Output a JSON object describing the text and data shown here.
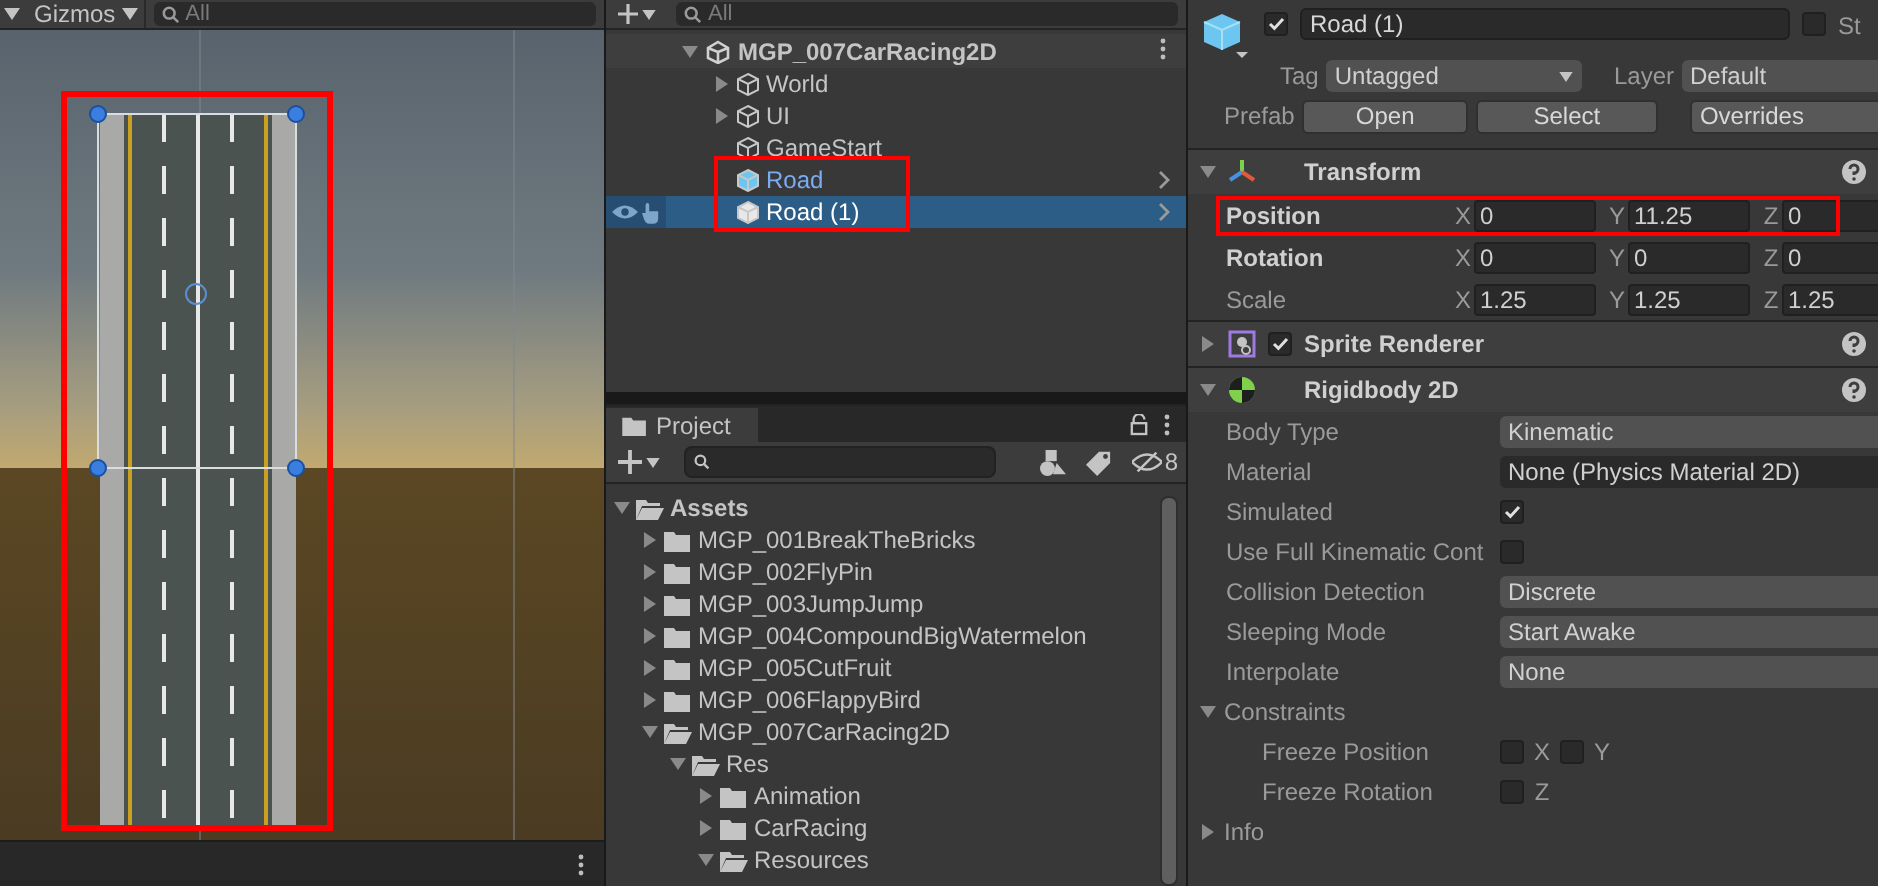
{
  "scene_view": {
    "gizmos_label": "Gizmos",
    "search_placeholder": "All"
  },
  "hierarchy": {
    "search_placeholder": "All",
    "scene": {
      "name": "MGP_007CarRacing2D",
      "expanded": true
    },
    "items": [
      {
        "name": "World",
        "kind": "object",
        "expanded": false,
        "selected": false
      },
      {
        "name": "UI",
        "kind": "object",
        "expanded": false,
        "selected": false
      },
      {
        "name": "GameStart",
        "kind": "object",
        "selected": false
      },
      {
        "name": "Road",
        "kind": "prefab",
        "selected": false
      },
      {
        "name": "Road (1)",
        "kind": "prefab",
        "selected": true
      }
    ]
  },
  "project": {
    "tab": "Project",
    "hidden_count": "8",
    "tree": [
      {
        "name": "Assets",
        "expanded": true,
        "children": [
          {
            "name": "MGP_001BreakTheBricks",
            "expanded": false
          },
          {
            "name": "MGP_002FlyPin",
            "expanded": false
          },
          {
            "name": "MGP_003JumpJump",
            "expanded": false
          },
          {
            "name": "MGP_004CompoundBigWatermelon",
            "expanded": false
          },
          {
            "name": "MGP_005CutFruit",
            "expanded": false
          },
          {
            "name": "MGP_006FlappyBird",
            "expanded": false
          },
          {
            "name": "MGP_007CarRacing2D",
            "expanded": true,
            "children": [
              {
                "name": "Res",
                "expanded": true,
                "children": [
                  {
                    "name": "Animation",
                    "expanded": false
                  },
                  {
                    "name": "CarRacing",
                    "expanded": false
                  },
                  {
                    "name": "Resources",
                    "expanded": true
                  }
                ]
              }
            ]
          }
        ]
      }
    ]
  },
  "inspector": {
    "name": "Road (1)",
    "active": true,
    "static_label": "St",
    "static": false,
    "tag_label": "Tag",
    "tag": "Untagged",
    "layer_label": "Layer",
    "layer": "Default",
    "prefab_label": "Prefab",
    "prefab_buttons": [
      "Open",
      "Select",
      "Overrides"
    ],
    "components": [
      {
        "kind": "transform",
        "title": "Transform",
        "expanded": true,
        "rows": [
          {
            "label": "Position",
            "overridden": true,
            "fields": [
              {
                "axis": "X",
                "value": "0"
              },
              {
                "axis": "Y",
                "value": "11.25"
              },
              {
                "axis": "Z",
                "value": "0"
              }
            ]
          },
          {
            "label": "Rotation",
            "overridden": true,
            "fields": [
              {
                "axis": "X",
                "value": "0"
              },
              {
                "axis": "Y",
                "value": "0"
              },
              {
                "axis": "Z",
                "value": "0"
              }
            ]
          },
          {
            "label": "Scale",
            "overridden": false,
            "fields": [
              {
                "axis": "X",
                "value": "1.25"
              },
              {
                "axis": "Y",
                "value": "1.25"
              },
              {
                "axis": "Z",
                "value": "1.25"
              }
            ]
          }
        ]
      },
      {
        "kind": "sprite_renderer",
        "title": "Sprite Renderer",
        "expanded": false,
        "enabled": true
      },
      {
        "kind": "rigidbody2d",
        "title": "Rigidbody 2D",
        "expanded": true,
        "properties": [
          {
            "kind": "dropdown",
            "label": "Body Type",
            "value": "Kinematic"
          },
          {
            "kind": "object",
            "label": "Material",
            "value": "None (Physics Material 2D)"
          },
          {
            "kind": "toggle",
            "label": "Simulated",
            "checked": true
          },
          {
            "kind": "toggle",
            "label": "Use Full Kinematic Cont",
            "checked": false
          },
          {
            "kind": "dropdown",
            "label": "Collision Detection",
            "value": "Discrete"
          },
          {
            "kind": "dropdown",
            "label": "Sleeping Mode",
            "value": "Start Awake"
          },
          {
            "kind": "dropdown",
            "label": "Interpolate",
            "value": "None"
          },
          {
            "kind": "foldout",
            "label": "Constraints",
            "expanded": true
          },
          {
            "kind": "axes",
            "label": "Freeze Position",
            "axes": [
              {
                "axis": "X",
                "checked": false
              },
              {
                "axis": "Y",
                "checked": false
              }
            ]
          },
          {
            "kind": "axes",
            "label": "Freeze Rotation",
            "axes": [
              {
                "axis": "Z",
                "checked": false
              }
            ]
          },
          {
            "kind": "section",
            "label": "Info",
            "expanded": false
          }
        ]
      }
    ]
  }
}
